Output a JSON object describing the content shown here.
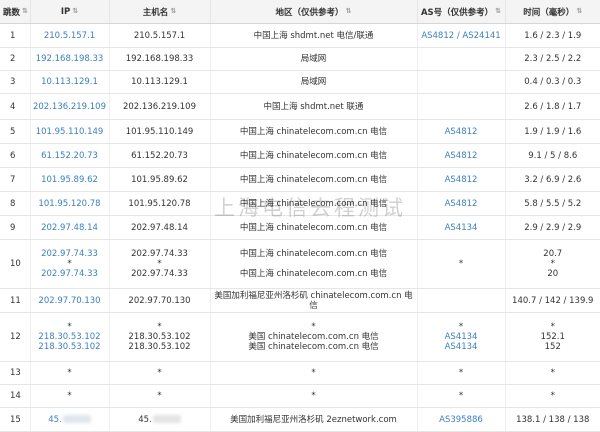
{
  "headers": {
    "hop": "跳数",
    "ip": "IP",
    "host": "主机名",
    "region": "地区（仅供参考）",
    "as": "AS号（仅供参考）",
    "time": "时间（毫秒）"
  },
  "watermark": "上海电信去程测试",
  "rows": [
    {
      "hop": "1",
      "ip": [
        "210.5.157.1"
      ],
      "host": [
        "210.5.157.1"
      ],
      "region": [
        "中国上海 shdmt.net 电信/联通"
      ],
      "as": [
        "AS4812 / AS24141"
      ],
      "time": [
        "1.6 / 2.3 / 1.9"
      ]
    },
    {
      "hop": "2",
      "ip": [
        "192.168.198.33"
      ],
      "host": [
        "192.168.198.33"
      ],
      "region": [
        "局域网"
      ],
      "as": [
        ""
      ],
      "time": [
        "2.3 / 2.5 / 2.2"
      ]
    },
    {
      "hop": "3",
      "ip": [
        "10.113.129.1"
      ],
      "host": [
        "10.113.129.1"
      ],
      "region": [
        "局域网"
      ],
      "as": [
        ""
      ],
      "time": [
        "0.4 / 0.3 / 0.3"
      ]
    },
    {
      "hop": "4",
      "ip": [
        "202.136.219.109"
      ],
      "host": [
        "202.136.219.109"
      ],
      "region": [
        "中国上海 shdmt.net 联通"
      ],
      "as": [
        ""
      ],
      "time": [
        "2.6 / 1.8 / 1.7"
      ]
    },
    {
      "hop": "5",
      "ip": [
        "101.95.110.149"
      ],
      "host": [
        "101.95.110.149"
      ],
      "region": [
        "中国上海 chinatelecom.com.cn 电信"
      ],
      "as": [
        "AS4812"
      ],
      "time": [
        "1.9 / 1.9 / 1.6"
      ]
    },
    {
      "hop": "6",
      "ip": [
        "61.152.20.73"
      ],
      "host": [
        "61.152.20.73"
      ],
      "region": [
        "中国上海 chinatelecom.com.cn 电信"
      ],
      "as": [
        "AS4812"
      ],
      "time": [
        "9.1 / 5 / 8.6"
      ]
    },
    {
      "hop": "7",
      "ip": [
        "101.95.89.62"
      ],
      "host": [
        "101.95.89.62"
      ],
      "region": [
        "中国上海 chinatelecom.com.cn 电信"
      ],
      "as": [
        "AS4812"
      ],
      "time": [
        "3.2 / 6.9 / 2.6"
      ]
    },
    {
      "hop": "8",
      "ip": [
        "101.95.120.78"
      ],
      "host": [
        "101.95.120.78"
      ],
      "region": [
        "中国上海 chinatelecom.com.cn 电信"
      ],
      "as": [
        "AS4812"
      ],
      "time": [
        "5.8 / 5.5 / 5.2"
      ]
    },
    {
      "hop": "9",
      "ip": [
        "202.97.48.14"
      ],
      "host": [
        "202.97.48.14"
      ],
      "region": [
        "中国上海 chinatelecom.com.cn 电信"
      ],
      "as": [
        "AS4134"
      ],
      "time": [
        "2.9 / 2.9 / 2.9"
      ]
    },
    {
      "hop": "10",
      "ip": [
        "202.97.74.33",
        "*",
        "202.97.74.33"
      ],
      "host": [
        "202.97.74.33",
        "*",
        "202.97.74.33"
      ],
      "region": [
        "中国上海 chinatelecom.com.cn 电信",
        "",
        "中国上海 chinatelecom.com.cn 电信"
      ],
      "as": [
        "",
        "*",
        ""
      ],
      "time": [
        "20.7",
        "*",
        "20"
      ]
    },
    {
      "hop": "11",
      "ip": [
        "202.97.70.130"
      ],
      "host": [
        "202.97.70.130"
      ],
      "region": [
        "美国加利福尼亚州洛杉矶 chinatelecom.com.cn 电信"
      ],
      "as": [
        ""
      ],
      "time": [
        "140.7 / 142 / 139.9"
      ]
    },
    {
      "hop": "12",
      "ip": [
        "*",
        "218.30.53.102",
        "218.30.53.102"
      ],
      "host": [
        "*",
        "218.30.53.102",
        "218.30.53.102"
      ],
      "region": [
        "*",
        "美国 chinatelecom.com.cn 电信",
        "美国 chinatelecom.com.cn 电信"
      ],
      "as": [
        "*",
        "AS4134",
        "AS4134"
      ],
      "time": [
        "*",
        "152.1",
        "152"
      ]
    },
    {
      "hop": "13",
      "ip": [
        "*"
      ],
      "host": [
        "*"
      ],
      "region": [
        "*"
      ],
      "as": [
        "*"
      ],
      "time": [
        "*"
      ]
    },
    {
      "hop": "14",
      "ip": [
        "*"
      ],
      "host": [
        "*"
      ],
      "region": [
        "*"
      ],
      "as": [
        "*"
      ],
      "time": [
        "*"
      ]
    },
    {
      "hop": "15",
      "ip": [
        "45."
      ],
      "host": [
        "45."
      ],
      "region": [
        "美国加利福尼亚州洛杉矶 2eznetwork.com"
      ],
      "as": [
        "AS395886"
      ],
      "time": [
        "138.1 / 138 / 138"
      ]
    }
  ]
}
